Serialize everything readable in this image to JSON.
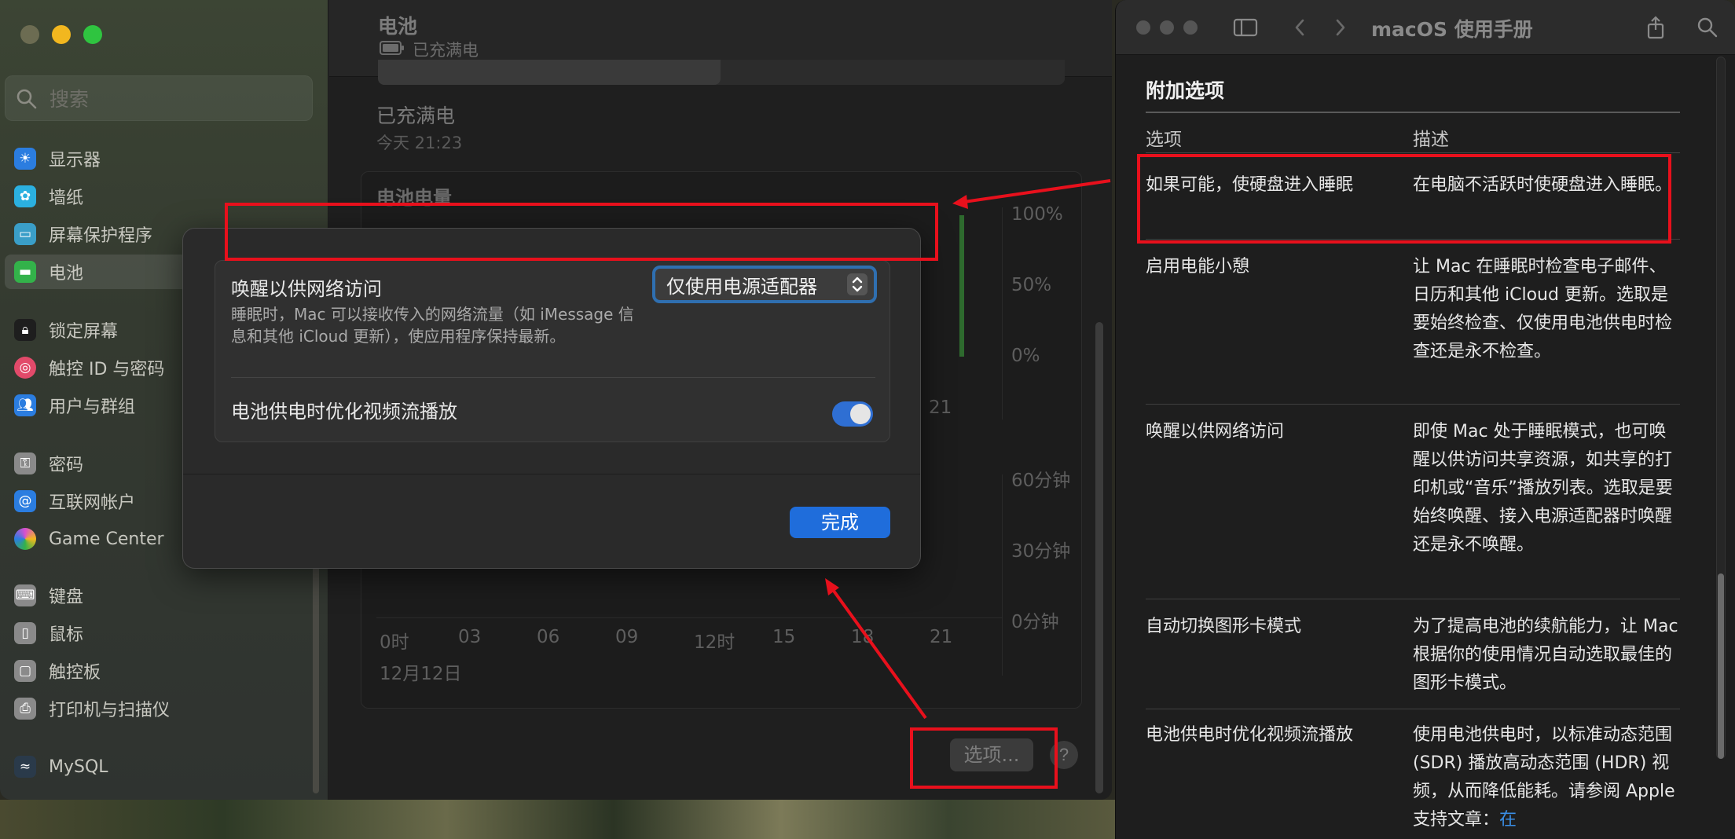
{
  "sidebar": {
    "search_placeholder": "搜索",
    "items": [
      {
        "label": "显示器",
        "icon": "sun-icon",
        "color": "#2b7de0"
      },
      {
        "label": "墙纸",
        "icon": "flower-icon",
        "color": "#2bb0e0"
      },
      {
        "label": "屏幕保护程序",
        "icon": "screensaver-icon",
        "color": "#3a9ec8"
      },
      {
        "label": "电池",
        "icon": "battery-icon",
        "color": "#33b24a"
      },
      {
        "label": "锁定屏幕",
        "icon": "lock-icon",
        "color": "#1e1e1e"
      },
      {
        "label": "触控 ID 与密码",
        "icon": "fingerprint-icon",
        "color": "#e24a6a"
      },
      {
        "label": "用户与群组",
        "icon": "users-icon",
        "color": "#2b7de0"
      },
      {
        "label": "密码",
        "icon": "key-icon",
        "color": "#8a8a8a"
      },
      {
        "label": "互联网帐户",
        "icon": "at-icon",
        "color": "#2b7de0"
      },
      {
        "label": "Game Center",
        "icon": "gamecenter-icon",
        "color": "#d94fd0"
      },
      {
        "label": "键盘",
        "icon": "keyboard-icon",
        "color": "#8a8a8a"
      },
      {
        "label": "鼠标",
        "icon": "mouse-icon",
        "color": "#8a8a8a"
      },
      {
        "label": "触控板",
        "icon": "trackpad-icon",
        "color": "#8a8a8a"
      },
      {
        "label": "打印机与扫描仪",
        "icon": "printer-icon",
        "color": "#8a8a8a"
      },
      {
        "label": "MySQL",
        "icon": "mysql-icon",
        "color": "#2a3a4a"
      }
    ]
  },
  "main": {
    "title": "电池",
    "subtitle": "已充满电",
    "charge_state": "已充满电",
    "charge_time": "今天 21:23",
    "level_title": "电池电量",
    "percent_ticks": [
      "100%",
      "50%",
      "0%"
    ],
    "minute_ticks": [
      "60分钟",
      "30分钟",
      "0分钟"
    ],
    "hour_ticks": [
      "0时",
      "03",
      "06",
      "09",
      "12时",
      "15",
      "18",
      "21"
    ],
    "upper_hour_tick": "21",
    "date_label": "12月12日",
    "options_label": "选项...",
    "help_label": "?"
  },
  "dialog": {
    "wake_title": "唤醒以供网络访问",
    "wake_desc": "睡眠时，Mac 可以接收传入的网络流量（如 iMessage 信息和其他 iCloud 更新），使应用程序保持最新。",
    "wake_value": "仅使用电源适配器",
    "video_label": "电池供电时优化视频流播放",
    "video_on": true,
    "done_label": "完成"
  },
  "help": {
    "title": "macOS 使用手册",
    "section_title": "附加选项",
    "col_option": "选项",
    "col_desc": "描述",
    "rows": [
      {
        "name": "如果可能，使硬盘进入睡眠",
        "desc": "在电脑不活跃时使硬盘进入睡眠。"
      },
      {
        "name": "启用电能小憩",
        "desc": "让 Mac 在睡眠时检查电子邮件、日历和其他 iCloud 更新。选取是要始终检查、仅使用电池供电时检查还是永不检查。"
      },
      {
        "name": "唤醒以供网络访问",
        "desc": "即使 Mac 处于睡眠模式，也可唤醒以供访问共享资源，如共享的打印机或“音乐”播放列表。选取是要始终唤醒、接入电源适配器时唤醒还是永不唤醒。"
      },
      {
        "name": "自动切换图形卡模式",
        "desc": "为了提高电池的续航能力，让 Mac 根据你的使用情况自动选取最佳的图形卡模式。"
      },
      {
        "name": "电池供电时优化视频流播放",
        "desc": "使用电池供电时，以标准动态范围 (SDR) 播放高动态范围 (HDR) 视频，从而降低能耗。请参阅 Apple 支持文章："
      }
    ],
    "link_text": "在"
  },
  "colors": {
    "annotation_red": "#e8101c",
    "accent_blue": "#1f6ddb",
    "chart_green": "#2e6a2e"
  }
}
